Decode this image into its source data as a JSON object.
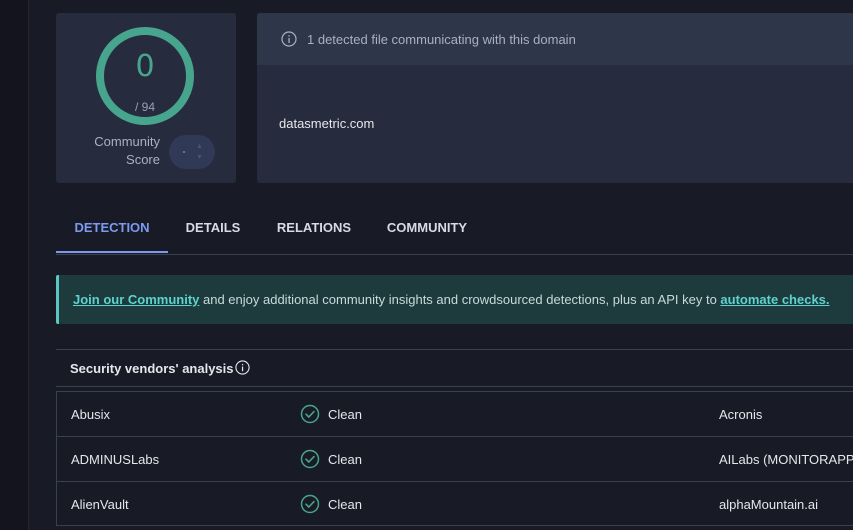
{
  "score": {
    "value": "0",
    "total": "/ 94",
    "community_label_line1": "Community",
    "community_label_line2": "Score",
    "ring_color": "#48a58d"
  },
  "domain_card": {
    "header_text": "1 detected file communicating with this domain",
    "domain": "datasmetric.com"
  },
  "tabs": [
    {
      "label": "DETECTION",
      "active": true
    },
    {
      "label": "DETAILS",
      "active": false
    },
    {
      "label": "RELATIONS",
      "active": false
    },
    {
      "label": "COMMUNITY",
      "active": false
    }
  ],
  "banner": {
    "link1": "Join our Community",
    "text": " and enjoy additional community insights and crowdsourced detections, plus an API key to ",
    "link2": "automate checks."
  },
  "analysis": {
    "title": "Security vendors' analysis"
  },
  "vendors": [
    {
      "name": "Abusix",
      "status": "Clean",
      "name2": "Acronis"
    },
    {
      "name": "ADMINUSLabs",
      "status": "Clean",
      "name2": "AILabs (MONITORAPP)"
    },
    {
      "name": "AlienVault",
      "status": "Clean",
      "name2": "alphaMountain.ai"
    }
  ],
  "colors": {
    "accent": "#7b9af0",
    "clean": "#48a58d",
    "banner_link": "#5ed3cd"
  }
}
